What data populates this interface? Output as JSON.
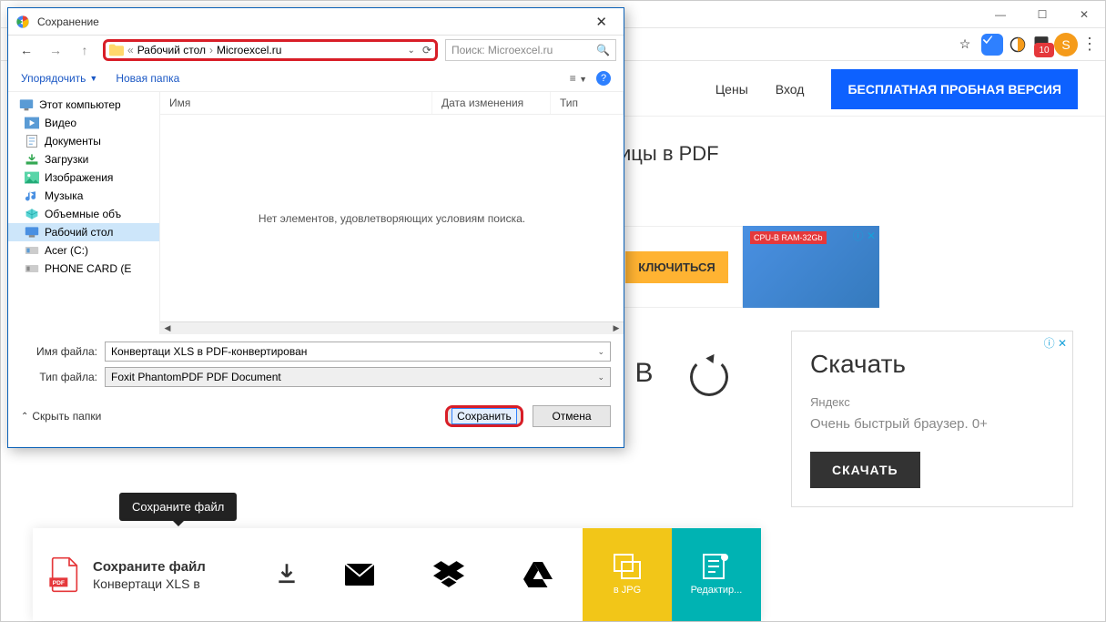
{
  "browser": {
    "ext_badge": "10",
    "avatar_letter": "S"
  },
  "page": {
    "nav_prices": "Цены",
    "nav_login": "Вход",
    "trial_btn": "БЕСПЛАТНАЯ ПРОБНАЯ ВЕРСИЯ",
    "headline_partial": "ицы в PDF",
    "bannerad_btn": "КЛЮЧИТЬСЯ",
    "bannerad_tag": "CPU-B RAM-32Gb",
    "progress_letter": "В",
    "sidead_title": "Скачать",
    "sidead_sub": "Яндекс",
    "sidead_desc": "Очень быстрый браузер. 0+",
    "sidead_btn": "СКАЧАТЬ",
    "tooltip": "Сохраните файл",
    "ab_first_t1": "Сохраните файл",
    "ab_first_t2": "Конвертаци XLS в",
    "ab_jpg": "в JPG",
    "ab_edit": "Редактир..."
  },
  "dialog": {
    "title": "Сохранение",
    "crumb1": "Рабочий стол",
    "crumb2": "Microexcel.ru",
    "search_placeholder": "Поиск: Microexcel.ru",
    "organize": "Упорядочить",
    "newfolder": "Новая папка",
    "cols": {
      "name": "Имя",
      "date": "Дата изменения",
      "type": "Тип"
    },
    "empty_msg": "Нет элементов, удовлетворяющих условиям поиска.",
    "filename_label": "Имя файла:",
    "filetype_label": "Тип файла:",
    "filename_value": "Конвертаци XLS в PDF-конвертирован",
    "filetype_value": "Foxit PhantomPDF PDF Document",
    "hide_folders": "Скрыть папки",
    "save_btn": "Сохранить",
    "cancel_btn": "Отмена",
    "tree": {
      "computer": "Этот компьютер",
      "video": "Видео",
      "docs": "Документы",
      "downloads": "Загрузки",
      "images": "Изображения",
      "music": "Музыка",
      "objects": "Объемные объ",
      "desktop": "Рабочий стол",
      "acer": "Acer (C:)",
      "phone": "PHONE CARD (E"
    }
  }
}
